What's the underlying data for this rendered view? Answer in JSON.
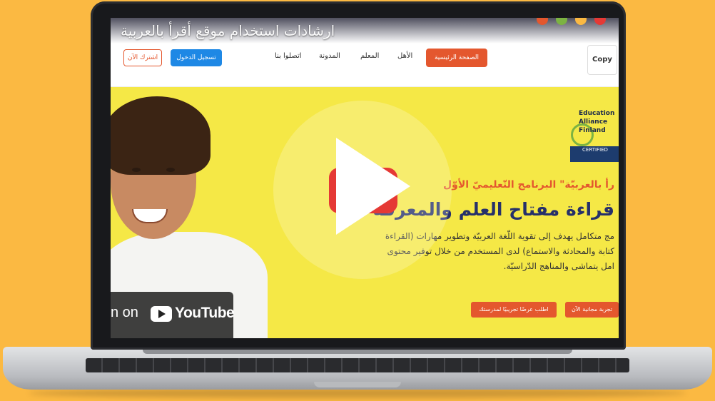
{
  "video": {
    "title": "ارشادات استخدام موقع أقرأ بالعربية",
    "watch_on": "n on",
    "youtube_wordmark": "YouTube"
  },
  "nav": {
    "subscribe": "اشترك الآن",
    "login": "تسجيل الدخول",
    "items": [
      "اتصلوا بنا",
      "المدونة",
      "المعلم",
      "الأهل"
    ],
    "home": "الصفحة الرئيسية",
    "logo_text": "Copy"
  },
  "hero": {
    "badge_line1": "Education",
    "badge_line2": "Alliance",
    "badge_line3": "Finland",
    "badge_cert": "CERTIFIED",
    "subhead": "رأ بالعربيّة\" البرنامج التّعليميّ الأوّل",
    "headline": "قراءة مفتاح العلم والمعرفة",
    "desc_line1": "مج متكامل يهدف إلى تقوية اللّغة العربيّة وتطوير مهارات (القراءة",
    "desc_line2": "كتابة والمحادثة والاستماع) لدى المستخدم من خلال توفير محتوى",
    "desc_line3": "امل يتماشى والمناهج الدّراسيّة.",
    "cta_school": "اطلب عرضًا تجريبيًا لمدرستك",
    "cta_trial": "تجربة مجانية الآن"
  },
  "colors": {
    "background": "#fbb942",
    "hero_bg": "#f5e846",
    "accent": "#e4572e",
    "login": "#1e88e5",
    "headline": "#26306a"
  }
}
